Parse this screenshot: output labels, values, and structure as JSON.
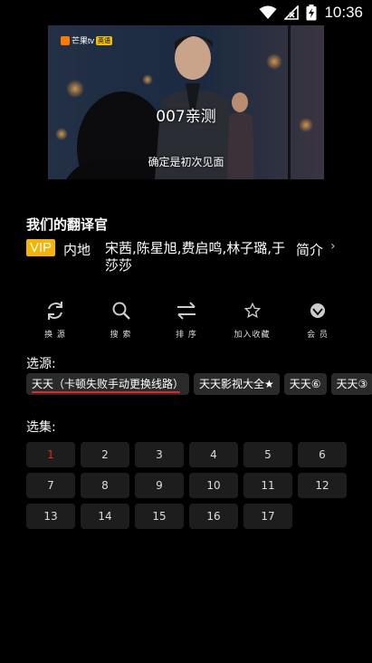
{
  "status_bar": {
    "time": "10:36"
  },
  "video": {
    "logo_text": "芒果tv",
    "logo_badge": "英语",
    "watermark": "007亲测",
    "subtitle": "确定是初次见面"
  },
  "show": {
    "title": "我们的翻译官",
    "vip": "VIP",
    "region": "内地",
    "cast": "宋茜,陈星旭,费启鸣,林子璐,于莎莎",
    "intro": "简介",
    "intro_chevron": "›"
  },
  "actions": [
    {
      "label": "换 源",
      "icon": "refresh-icon"
    },
    {
      "label": "搜 索",
      "icon": "search-icon"
    },
    {
      "label": "排 序",
      "icon": "sort-icon"
    },
    {
      "label": "加入收藏",
      "icon": "star-icon"
    },
    {
      "label": "会 员",
      "icon": "vip-crown-icon"
    }
  ],
  "sources": {
    "label": "选源:",
    "items": [
      "天天（卡顿失败手动更换线路）",
      "天天影视大全★",
      "天天⑥",
      "天天③"
    ],
    "active_index": 0
  },
  "episodes": {
    "label": "选集:",
    "items": [
      "1",
      "2",
      "3",
      "4",
      "5",
      "6",
      "7",
      "8",
      "9",
      "10",
      "11",
      "12",
      "13",
      "14",
      "15",
      "16",
      "17"
    ],
    "current": "1"
  },
  "colors": {
    "accent": "#e02828",
    "vip": "#f5b400",
    "chip_bg": "#2a2a2a",
    "episode_bg": "#1d1d1d"
  }
}
